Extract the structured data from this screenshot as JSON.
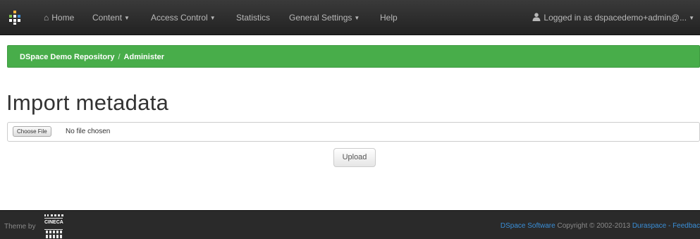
{
  "navbar": {
    "home": "Home",
    "content": "Content",
    "access_control": "Access Control",
    "statistics": "Statistics",
    "general_settings": "General Settings",
    "help": "Help",
    "user": "Logged in as dspacedemo+admin@..."
  },
  "breadcrumb": {
    "repository": "DSpace Demo Repository",
    "separator": "/",
    "current": "Administer"
  },
  "page": {
    "title": "Import metadata"
  },
  "file_input": {
    "button_label": "Choose File",
    "status": "No file chosen"
  },
  "upload_button": "Upload",
  "footer": {
    "theme_by": "Theme by",
    "logo_text": "CINECA",
    "dspace_link": "DSpace Software",
    "copyright": "Copyright © 2002-2013",
    "duraspace_link": "Duraspace",
    "dash": "-",
    "feedback_link": "Feedbac"
  },
  "colors": {
    "navbar_bg": "#2b2b2b",
    "breadcrumb_bg": "#48ad4a",
    "footer_bg": "#2a2a2a",
    "link": "#3a8fd8"
  }
}
